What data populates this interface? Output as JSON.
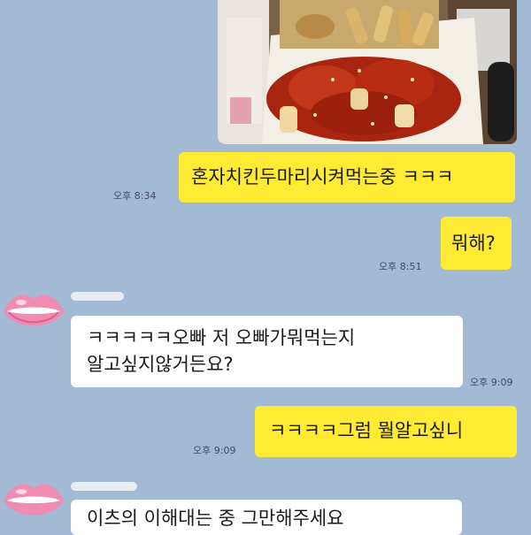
{
  "messages": [
    {
      "text": "혼자치킨두마리시켜먹는중 ㅋㅋㅋ",
      "time": "오후 8:34"
    },
    {
      "text": "뭐해?",
      "time": "오후 8:51"
    },
    {
      "line1": "ㅋㅋㅋㅋㅋ오빠 저 오빠가뭐먹는지",
      "line2": "알고싶지않거든요?",
      "time": "오후 9:09"
    },
    {
      "text": "ㅋㅋㅋㅋ그럼 뭘알고싶니",
      "time": "오후 9:09"
    },
    {
      "text": "이츠의 이해대는 중 그만해주세요"
    }
  ],
  "colors": {
    "background": "#a3bad4",
    "mine": "#ffeb33",
    "theirs": "#ffffff"
  },
  "icons": {
    "avatar": "lips-icon",
    "photo": "chicken-photo"
  }
}
